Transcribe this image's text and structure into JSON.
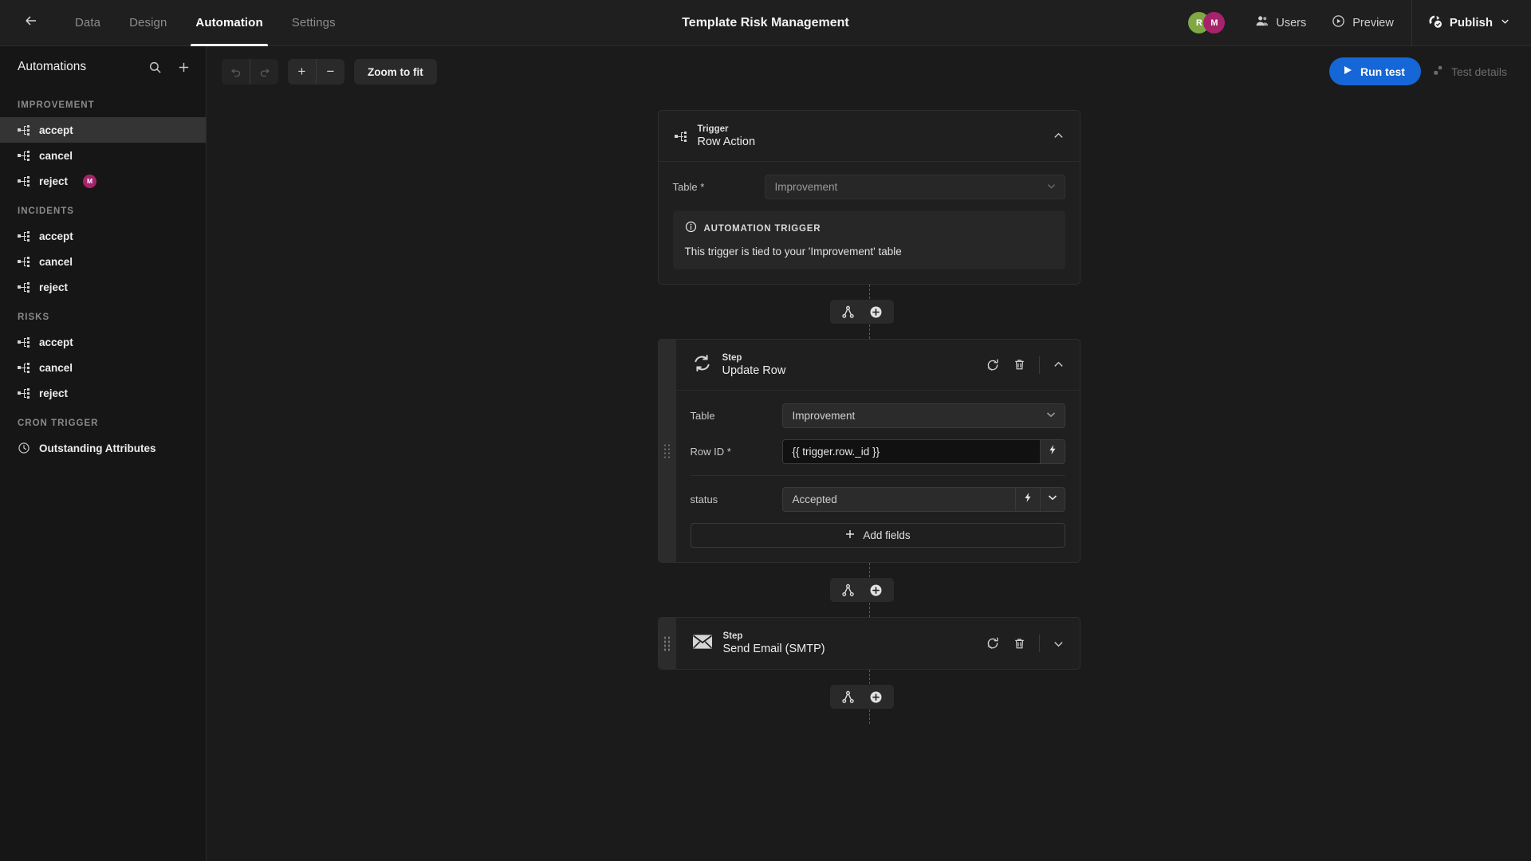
{
  "topbar": {
    "back_icon": "arrow-left-icon",
    "tabs": [
      {
        "label": "Data",
        "active": false
      },
      {
        "label": "Design",
        "active": false
      },
      {
        "label": "Automation",
        "active": true
      },
      {
        "label": "Settings",
        "active": false
      }
    ],
    "title": "Template Risk Management",
    "avatars": [
      {
        "initial": "R",
        "color": "#7fa844"
      },
      {
        "initial": "M",
        "color": "#a6236b"
      }
    ],
    "users_label": "Users",
    "users_icon": "users-icon",
    "preview_label": "Preview",
    "preview_icon": "play-circle-icon",
    "publish_label": "Publish",
    "publish_icon": "publish-globe-icon",
    "publish_chevron": "chevron-down-icon"
  },
  "sidebar": {
    "title": "Automations",
    "search_icon": "search-icon",
    "add_icon": "plus-icon",
    "groups": [
      {
        "label": "IMPROVEMENT",
        "items": [
          {
            "label": "accept",
            "icon": "automation-flow-icon",
            "selected": true,
            "badge": ""
          },
          {
            "label": "cancel",
            "icon": "automation-flow-icon",
            "selected": false,
            "badge": ""
          },
          {
            "label": "reject",
            "icon": "automation-flow-icon",
            "selected": false,
            "badge": "M"
          }
        ]
      },
      {
        "label": "INCIDENTS",
        "items": [
          {
            "label": "accept",
            "icon": "automation-flow-icon",
            "selected": false,
            "badge": ""
          },
          {
            "label": "cancel",
            "icon": "automation-flow-icon",
            "selected": false,
            "badge": ""
          },
          {
            "label": "reject",
            "icon": "automation-flow-icon",
            "selected": false,
            "badge": ""
          }
        ]
      },
      {
        "label": "RISKS",
        "items": [
          {
            "label": "accept",
            "icon": "automation-flow-icon",
            "selected": false,
            "badge": ""
          },
          {
            "label": "cancel",
            "icon": "automation-flow-icon",
            "selected": false,
            "badge": ""
          },
          {
            "label": "reject",
            "icon": "automation-flow-icon",
            "selected": false,
            "badge": ""
          }
        ]
      },
      {
        "label": "CRON TRIGGER",
        "items": [
          {
            "label": "Outstanding Attributes",
            "icon": "clock-icon",
            "selected": false,
            "badge": ""
          }
        ]
      }
    ],
    "badge_color": "#a6236b"
  },
  "toolbar": {
    "undo_icon": "undo-icon",
    "redo_icon": "redo-icon",
    "zoom_in_label": "+",
    "zoom_out_label": "−",
    "zoom_to_fit_label": "Zoom to fit",
    "run_test_label": "Run test",
    "run_test_icon": "play-icon",
    "run_test_color": "#1566d6",
    "test_details_label": "Test details",
    "test_details_icon": "test-details-icon"
  },
  "flow": {
    "trigger": {
      "kind": "Trigger",
      "name": "Row Action",
      "icon": "automation-flow-icon",
      "chevron": "chevron-up-icon",
      "table_label": "Table *",
      "table_value": "Improvement",
      "info_icon": "info-icon",
      "info_title": "AUTOMATION TRIGGER",
      "info_text": "This trigger is tied to your 'Improvement' table"
    },
    "connector": {
      "branch_icon": "branch-icon",
      "add_icon": "plus-circle-icon"
    },
    "steps": [
      {
        "kind": "Step",
        "name": "Update Row",
        "icon": "refresh-row-icon",
        "rerun_icon": "rerun-icon",
        "delete_icon": "trash-icon",
        "chevron": "chevron-up-icon",
        "expanded": true,
        "fields": {
          "table_label": "Table",
          "table_value": "Improvement",
          "rowid_label": "Row ID *",
          "rowid_value": "{{ trigger.row._id }}",
          "rowid_binding_icon": "lightning-icon",
          "status_label": "status",
          "status_value": "Accepted",
          "status_binding_icon": "lightning-icon",
          "status_chevron": "chevron-down-icon",
          "add_fields_label": "Add fields",
          "add_fields_icon": "plus-icon"
        }
      },
      {
        "kind": "Step",
        "name": "Send Email (SMTP)",
        "icon": "envelope-icon",
        "rerun_icon": "rerun-icon",
        "delete_icon": "trash-icon",
        "chevron": "chevron-down-icon",
        "expanded": false
      }
    ]
  }
}
